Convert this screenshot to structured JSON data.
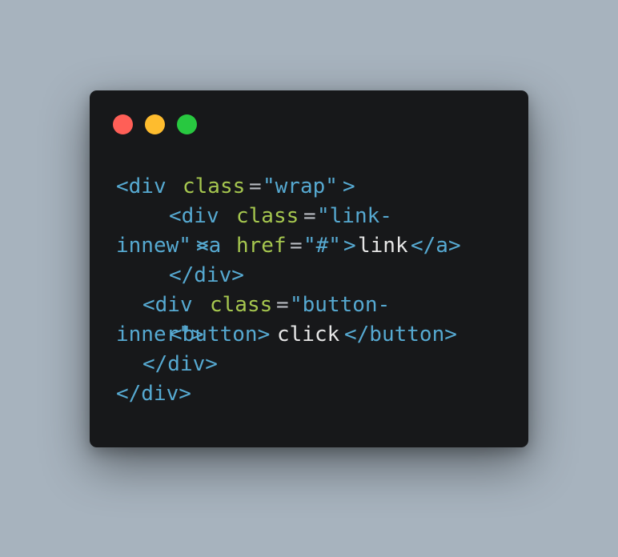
{
  "colors": {
    "background": "#a7b3be",
    "window": "#17181a",
    "close": "#ff5f57",
    "minimize": "#febc2e",
    "maximize": "#28c840",
    "tag": "#56a9d1",
    "attribute": "#a6c74f",
    "string": "#56a9d1",
    "text": "#e6e6e6"
  },
  "window_controls": [
    "close",
    "minimize",
    "maximize"
  ],
  "code": {
    "l1_tag_open": "<div ",
    "l1_attr": "class",
    "l1_eq": "=",
    "l1_value": "\"wrap\"",
    "l1_tag_close": ">",
    "l2_tag_open": "<div ",
    "l2_attr": "class",
    "l2_eq": "=",
    "l2_value": "\"link-",
    "l3_value_cont": "innew\"",
    "l3_overlap": ">",
    "l3_tag_open": "<a ",
    "l3_attr": "href",
    "l3_eq": "=",
    "l3_value": "\"#\"",
    "l3_tag_close": ">",
    "l3_text": "link",
    "l3_end_tag": "</a>",
    "l4_end_tag": "</div>",
    "l5_tag_open": "<div ",
    "l5_attr": "class",
    "l5_eq": "=",
    "l5_value": "\"button-",
    "l6_value_cont": "inner\">",
    "l6_tag_open": "<button>",
    "l6_text": "click",
    "l6_end_tag": "</button>",
    "l7_end_tag": "</div>",
    "l8_end_tag": "</div>"
  }
}
